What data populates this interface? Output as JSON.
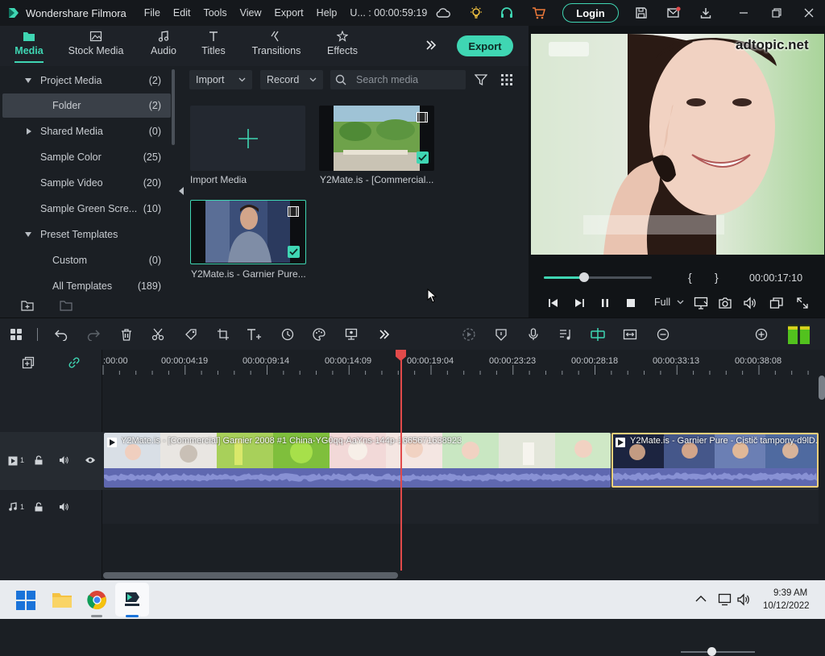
{
  "titlebar": {
    "app_name": "Wondershare Filmora",
    "menu": [
      "File",
      "Edit",
      "Tools",
      "View",
      "Export",
      "Help"
    ],
    "project": "U... : 00:00:59:19",
    "login_label": "Login"
  },
  "tabs": [
    {
      "label": "Media",
      "icon": "folder-icon"
    },
    {
      "label": "Stock Media",
      "icon": "image-icon"
    },
    {
      "label": "Audio",
      "icon": "music-note-icon"
    },
    {
      "label": "Titles",
      "icon": "text-icon"
    },
    {
      "label": "Transitions",
      "icon": "transition-icon"
    },
    {
      "label": "Effects",
      "icon": "effects-icon"
    }
  ],
  "export_label": "Export",
  "tree": [
    {
      "label": "Project Media",
      "count": "(2)",
      "expanded": true
    },
    {
      "label": "Folder",
      "count": "(2)",
      "selected": true
    },
    {
      "label": "Shared Media",
      "count": "(0)",
      "expanded": false
    },
    {
      "label": "Sample Color",
      "count": "(25)"
    },
    {
      "label": "Sample Video",
      "count": "(20)"
    },
    {
      "label": "Sample Green Scre...",
      "count": "(10)"
    },
    {
      "label": "Preset Templates",
      "count": "",
      "expanded": true
    },
    {
      "label": "Custom",
      "count": "(0)"
    },
    {
      "label": "All Templates",
      "count": "(189)"
    }
  ],
  "media_toolbar": {
    "import_label": "Import",
    "record_label": "Record",
    "search_placeholder": "Search media"
  },
  "media_items": [
    {
      "label": "Import Media"
    },
    {
      "label": "Y2Mate.is - [Commercial..."
    },
    {
      "label": "Y2Mate.is - Garnier Pure..."
    }
  ],
  "preview": {
    "watermark": "adtopic.net",
    "timecode": "00:00:17:10",
    "quality": "Full",
    "mark_in": "{",
    "mark_out": "}",
    "progress_fraction": 0.37
  },
  "timeline": {
    "ruler_labels": [
      ":00:00",
      "00:00:04:19",
      "00:00:09:14",
      "00:00:14:09",
      "00:00:19:04",
      "00:00:23:23",
      "00:00:28:18",
      "00:00:33:13",
      "00:00:38:08"
    ],
    "video_track_label": "1",
    "audio_track_label": "1",
    "clips": [
      {
        "title": "Y2Mate.is - [Commercial] Garnier 2008 #1 China-YG0qq-AaYns-144p-1665671638923"
      },
      {
        "title": "Y2Mate.is - Garnier Pure - Cistič tampony-d9lD..."
      }
    ]
  },
  "taskbar": {
    "time": "9:39 AM",
    "date": "10/12/2022"
  },
  "colors": {
    "accent": "#3fd6b3",
    "playhead": "#e24a4a",
    "selection_outline": "#f0d07a"
  }
}
